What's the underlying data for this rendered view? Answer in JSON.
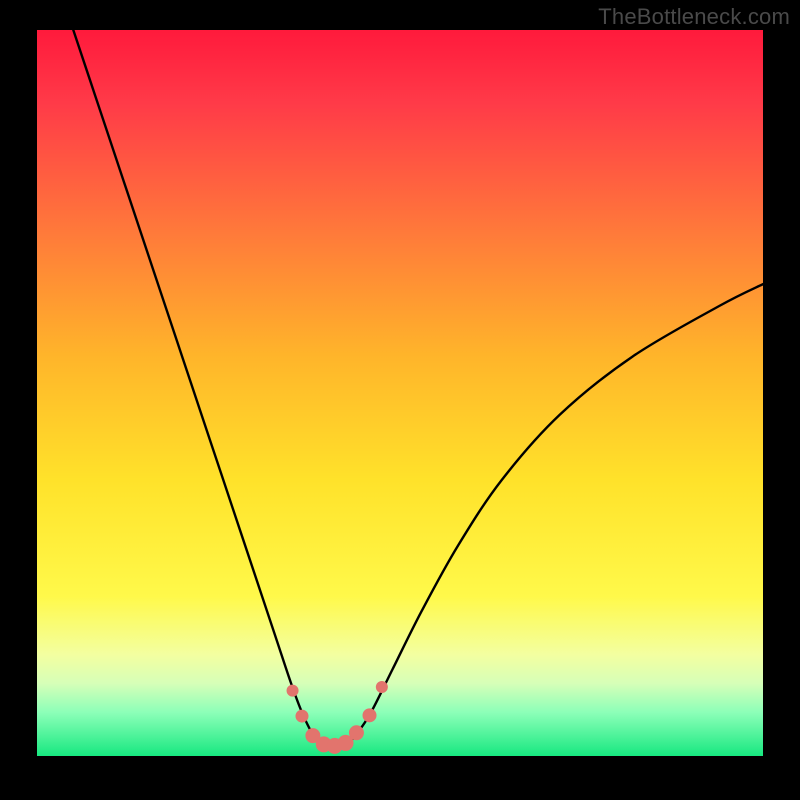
{
  "watermark": "TheBottleneck.com",
  "colors": {
    "background": "#000000",
    "gradient_stops": [
      {
        "offset": 0.0,
        "color": "#ff1a3c"
      },
      {
        "offset": 0.1,
        "color": "#ff3a48"
      },
      {
        "offset": 0.28,
        "color": "#ff7a3a"
      },
      {
        "offset": 0.45,
        "color": "#ffb52a"
      },
      {
        "offset": 0.62,
        "color": "#ffe22a"
      },
      {
        "offset": 0.78,
        "color": "#fff94a"
      },
      {
        "offset": 0.86,
        "color": "#f3ffa0"
      },
      {
        "offset": 0.9,
        "color": "#d6ffb8"
      },
      {
        "offset": 0.94,
        "color": "#8cffb8"
      },
      {
        "offset": 1.0,
        "color": "#17e880"
      }
    ],
    "curve": "#000000",
    "marker_fill": "#e2746d",
    "marker_stroke": "#e2746d"
  },
  "chart_data": {
    "type": "line",
    "title": "",
    "xlabel": "",
    "ylabel": "",
    "xlim": [
      0,
      100
    ],
    "ylim": [
      0,
      100
    ],
    "series": [
      {
        "name": "bottleneck-curve",
        "x": [
          5,
          8,
          12,
          16,
          20,
          24,
          28,
          31,
          33,
          35,
          36.5,
          38,
          39.5,
          41,
          42.5,
          44,
          46,
          49,
          53,
          58,
          64,
          72,
          82,
          94,
          100
        ],
        "y": [
          100,
          91,
          79,
          67,
          55,
          43,
          31,
          22,
          16,
          10,
          6,
          3,
          1.5,
          1.2,
          1.5,
          3,
          6,
          12,
          20,
          29,
          38,
          47,
          55,
          62,
          65
        ]
      }
    ],
    "markers": {
      "name": "highlight-dots",
      "x": [
        35.2,
        36.5,
        38.0,
        39.5,
        41.0,
        42.5,
        44.0,
        45.8,
        47.5
      ],
      "y": [
        9.0,
        5.5,
        2.8,
        1.6,
        1.4,
        1.8,
        3.2,
        5.6,
        9.5
      ],
      "r": [
        5.5,
        6.0,
        7.0,
        7.5,
        7.5,
        7.5,
        7.0,
        6.5,
        5.5
      ]
    }
  }
}
